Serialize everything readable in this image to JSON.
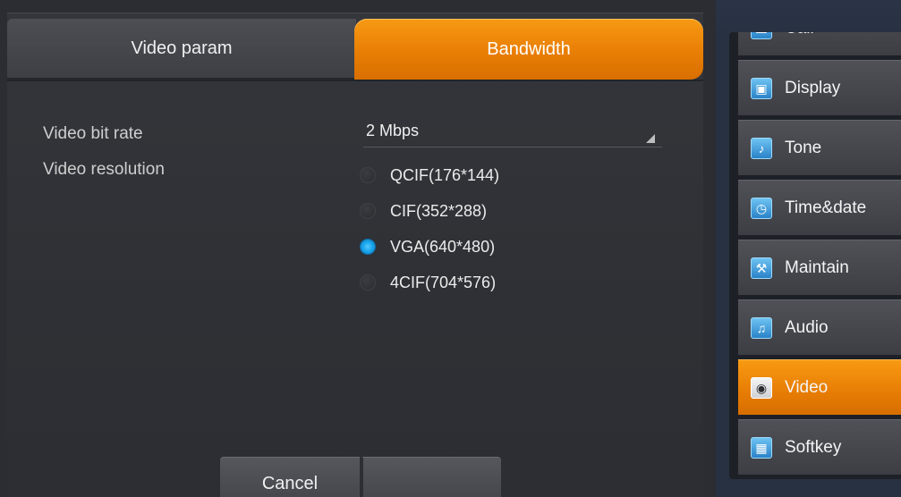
{
  "tabs": {
    "video_param": "Video param",
    "bandwidth": "Bandwidth"
  },
  "form": {
    "bitrate_label": "Video bit rate",
    "bitrate_value": "2 Mbps",
    "resolution_label": "Video resolution",
    "resolution_options": [
      {
        "label": "QCIF(176*144)",
        "checked": false
      },
      {
        "label": "CIF(352*288)",
        "checked": false
      },
      {
        "label": "VGA(640*480)",
        "checked": true
      },
      {
        "label": "4CIF(704*576)",
        "checked": false
      }
    ]
  },
  "buttons": {
    "cancel": "Cancel",
    "ok": ""
  },
  "sidebar": {
    "items": [
      {
        "label": "Call",
        "icon": "call-icon",
        "active": false
      },
      {
        "label": "Display",
        "icon": "display-icon",
        "active": false
      },
      {
        "label": "Tone",
        "icon": "tone-icon",
        "active": false
      },
      {
        "label": "Time&date",
        "icon": "clock-icon",
        "active": false
      },
      {
        "label": "Maintain",
        "icon": "maintain-icon",
        "active": false
      },
      {
        "label": "Audio",
        "icon": "audio-icon",
        "active": false
      },
      {
        "label": "Video",
        "icon": "video-icon",
        "active": true
      },
      {
        "label": "Softkey",
        "icon": "softkey-icon",
        "active": false
      }
    ]
  },
  "colors": {
    "accent_orange": "#e97e05",
    "radio_selected": "#1ba7ee",
    "sidebar_bg": "#283142"
  }
}
